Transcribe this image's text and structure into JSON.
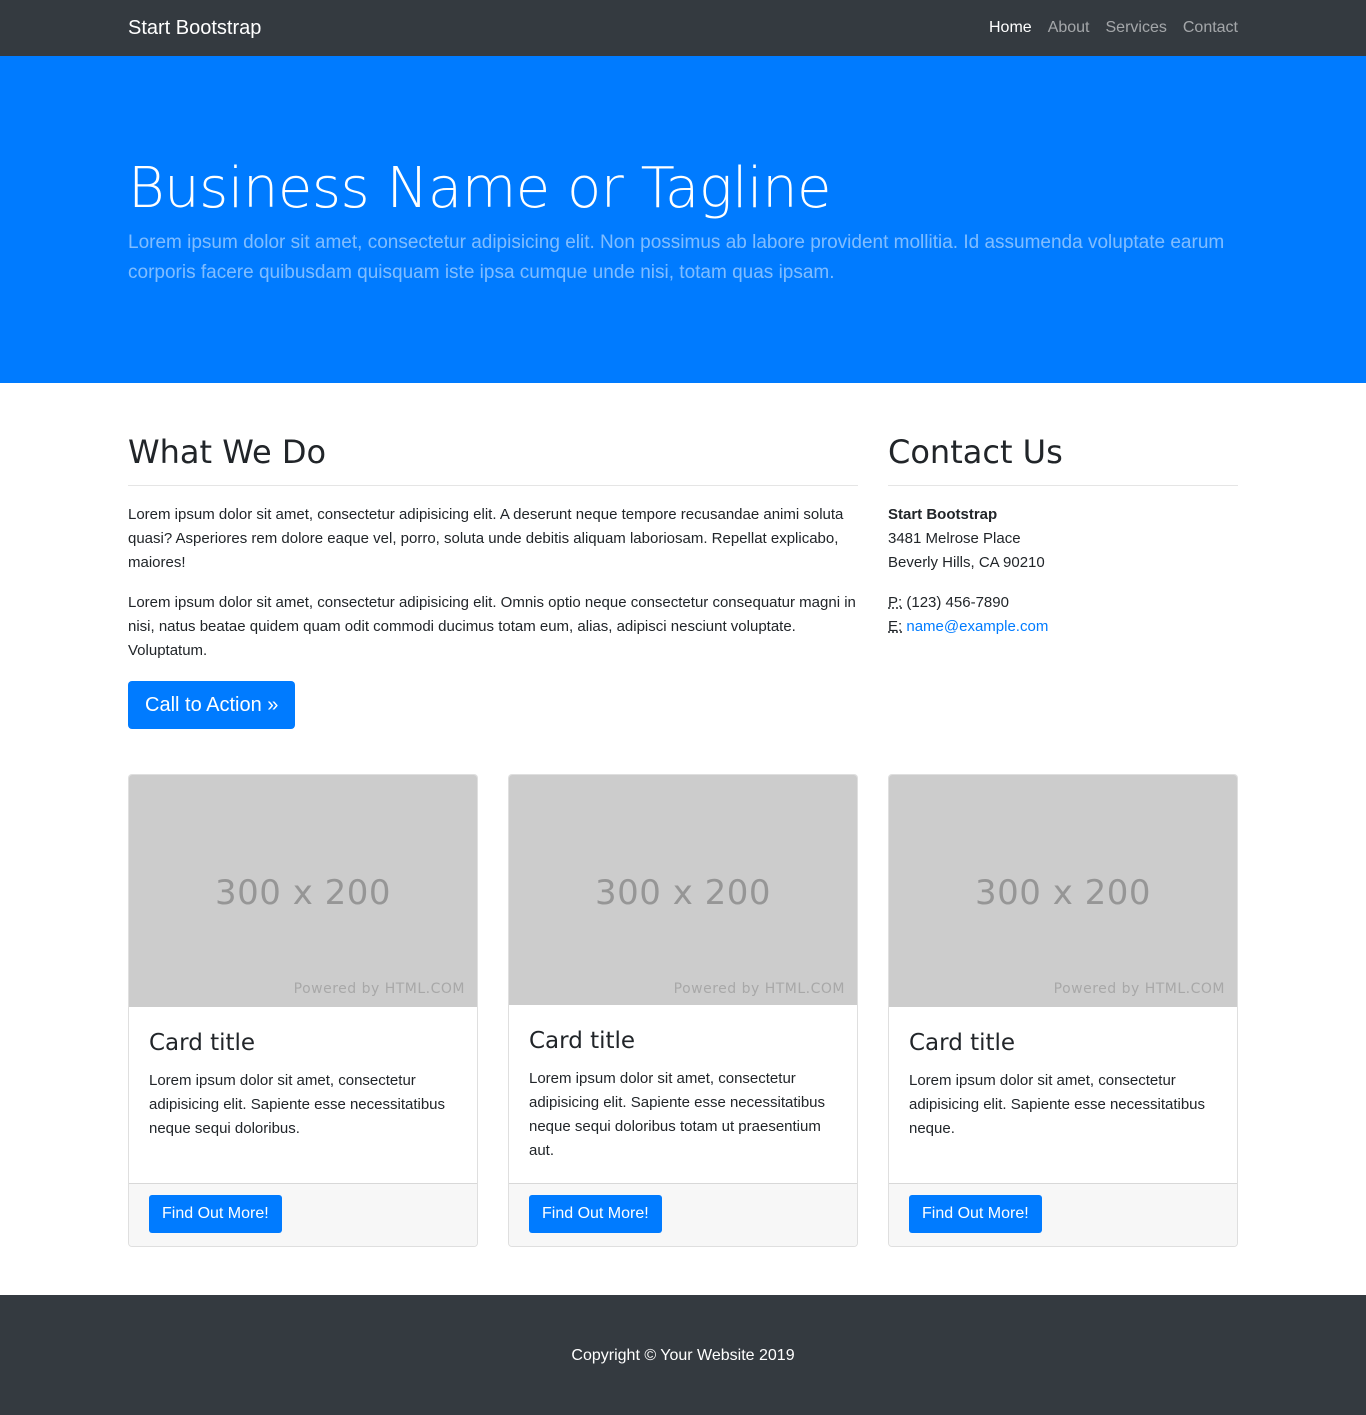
{
  "navbar": {
    "brand": "Start Bootstrap",
    "links": [
      {
        "label": "Home",
        "active": true
      },
      {
        "label": "About",
        "active": false
      },
      {
        "label": "Services",
        "active": false
      },
      {
        "label": "Contact",
        "active": false
      }
    ]
  },
  "hero": {
    "title": "Business Name or Tagline",
    "lead": "Lorem ipsum dolor sit amet, consectetur adipisicing elit. Non possimus ab labore provident mollitia. Id assumenda voluptate earum corporis facere quibusdam quisquam iste ipsa cumque unde nisi, totam quas ipsam."
  },
  "what_we_do": {
    "title": "What We Do",
    "paragraphs": [
      "Lorem ipsum dolor sit amet, consectetur adipisicing elit. A deserunt neque tempore recusandae animi soluta quasi? Asperiores rem dolore eaque vel, porro, soluta unde debitis aliquam laboriosam. Repellat explicabo, maiores!",
      "Lorem ipsum dolor sit amet, consectetur adipisicing elit. Omnis optio neque consectetur consequatur magni in nisi, natus beatae quidem quam odit commodi ducimus totam eum, alias, adipisci nesciunt voluptate. Voluptatum."
    ],
    "cta_label": "Call to Action »"
  },
  "contact": {
    "title": "Contact Us",
    "company": "Start Bootstrap",
    "street": "3481 Melrose Place",
    "city": "Beverly Hills, CA 90210",
    "phone_abbr": "P:",
    "phone": "(123) 456-7890",
    "email_abbr": "E:",
    "email": "name@example.com"
  },
  "cards": [
    {
      "placeholder_size": "300 x 200",
      "placeholder_credit": "Powered by HTML.COM",
      "title": "Card title",
      "text": "Lorem ipsum dolor sit amet, consectetur adipisicing elit. Sapiente esse necessitatibus neque sequi doloribus.",
      "button": "Find Out More!"
    },
    {
      "placeholder_size": "300 x 200",
      "placeholder_credit": "Powered by HTML.COM",
      "title": "Card title",
      "text": "Lorem ipsum dolor sit amet, consectetur adipisicing elit. Sapiente esse necessitatibus neque sequi doloribus totam ut praesentium aut.",
      "button": "Find Out More!"
    },
    {
      "placeholder_size": "300 x 200",
      "placeholder_credit": "Powered by HTML.COM",
      "title": "Card title",
      "text": "Lorem ipsum dolor sit amet, consectetur adipisicing elit. Sapiente esse necessitatibus neque.",
      "button": "Find Out More!"
    }
  ],
  "footer": {
    "copyright": "Copyright © Your Website 2019"
  },
  "colors": {
    "primary": "#007bff",
    "dark": "#343a40",
    "placeholder_bg": "#cccccc"
  }
}
